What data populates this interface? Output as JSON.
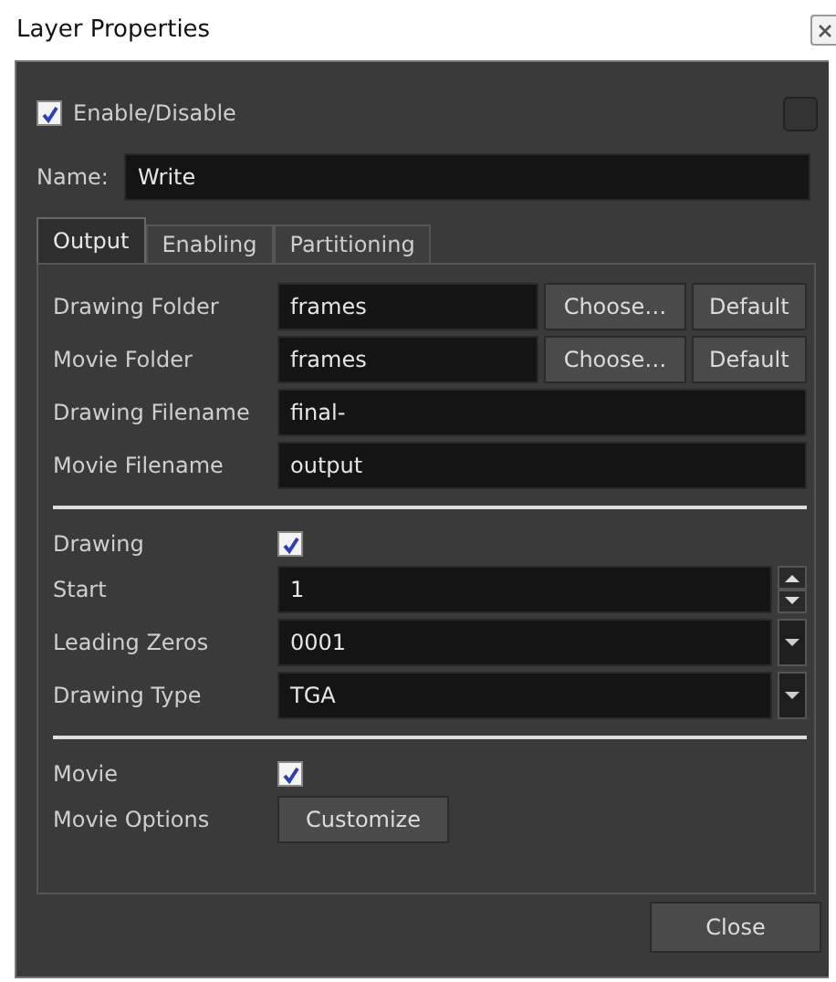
{
  "window": {
    "title": "Layer Properties"
  },
  "enable": {
    "label": "Enable/Disable",
    "checked": true
  },
  "corner_checkbox": {
    "checked": false
  },
  "name": {
    "label": "Name:",
    "value": "Write"
  },
  "tabs": [
    {
      "label": "Output",
      "selected": true
    },
    {
      "label": "Enabling",
      "selected": false
    },
    {
      "label": "Partitioning",
      "selected": false
    }
  ],
  "rows": [
    {
      "kind": "folder",
      "label": "Drawing Folder",
      "value": "frames",
      "buttons": [
        "Choose…",
        "Default"
      ]
    },
    {
      "kind": "folder",
      "label": "Movie Folder",
      "value": "frames",
      "buttons": [
        "Choose…",
        "Default"
      ]
    },
    {
      "kind": "text",
      "label": "Drawing Filename",
      "value": "final-"
    },
    {
      "kind": "text",
      "label": "Movie Filename",
      "value": "output"
    },
    {
      "kind": "separator"
    },
    {
      "kind": "checkbox",
      "label": "Drawing",
      "checked": true
    },
    {
      "kind": "spin",
      "label": "Start",
      "value": "1"
    },
    {
      "kind": "select",
      "label": "Leading Zeros",
      "value": "0001"
    },
    {
      "kind": "select",
      "label": "Drawing Type",
      "value": "TGA"
    },
    {
      "kind": "separator"
    },
    {
      "kind": "checkbox",
      "label": "Movie",
      "checked": true
    },
    {
      "kind": "button",
      "label": "Movie Options",
      "button": "Customize"
    }
  ],
  "close_button": "Close"
}
